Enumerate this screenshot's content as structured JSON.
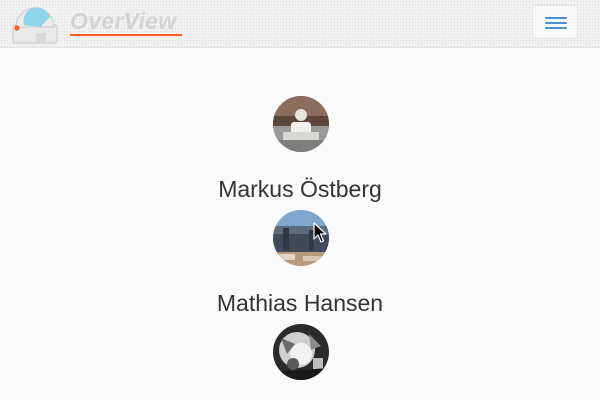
{
  "header": {
    "brand": "OverView",
    "logo_icon": "observatory-dome-icon",
    "menu_icon": "hamburger-menu-icon",
    "brand_color": "#d3d3d3",
    "accent_color": "#ff5a1f",
    "menu_icon_color": "#4a90d9"
  },
  "people": [
    {
      "name": "Markus Östberg",
      "avatar_icon": "portrait-photo"
    },
    {
      "name": "Mathias Hansen",
      "avatar_icon": "portrait-photo"
    },
    {
      "name": "",
      "avatar_icon": "portrait-photo"
    }
  ],
  "cursor_icon": "mouse-pointer-icon"
}
